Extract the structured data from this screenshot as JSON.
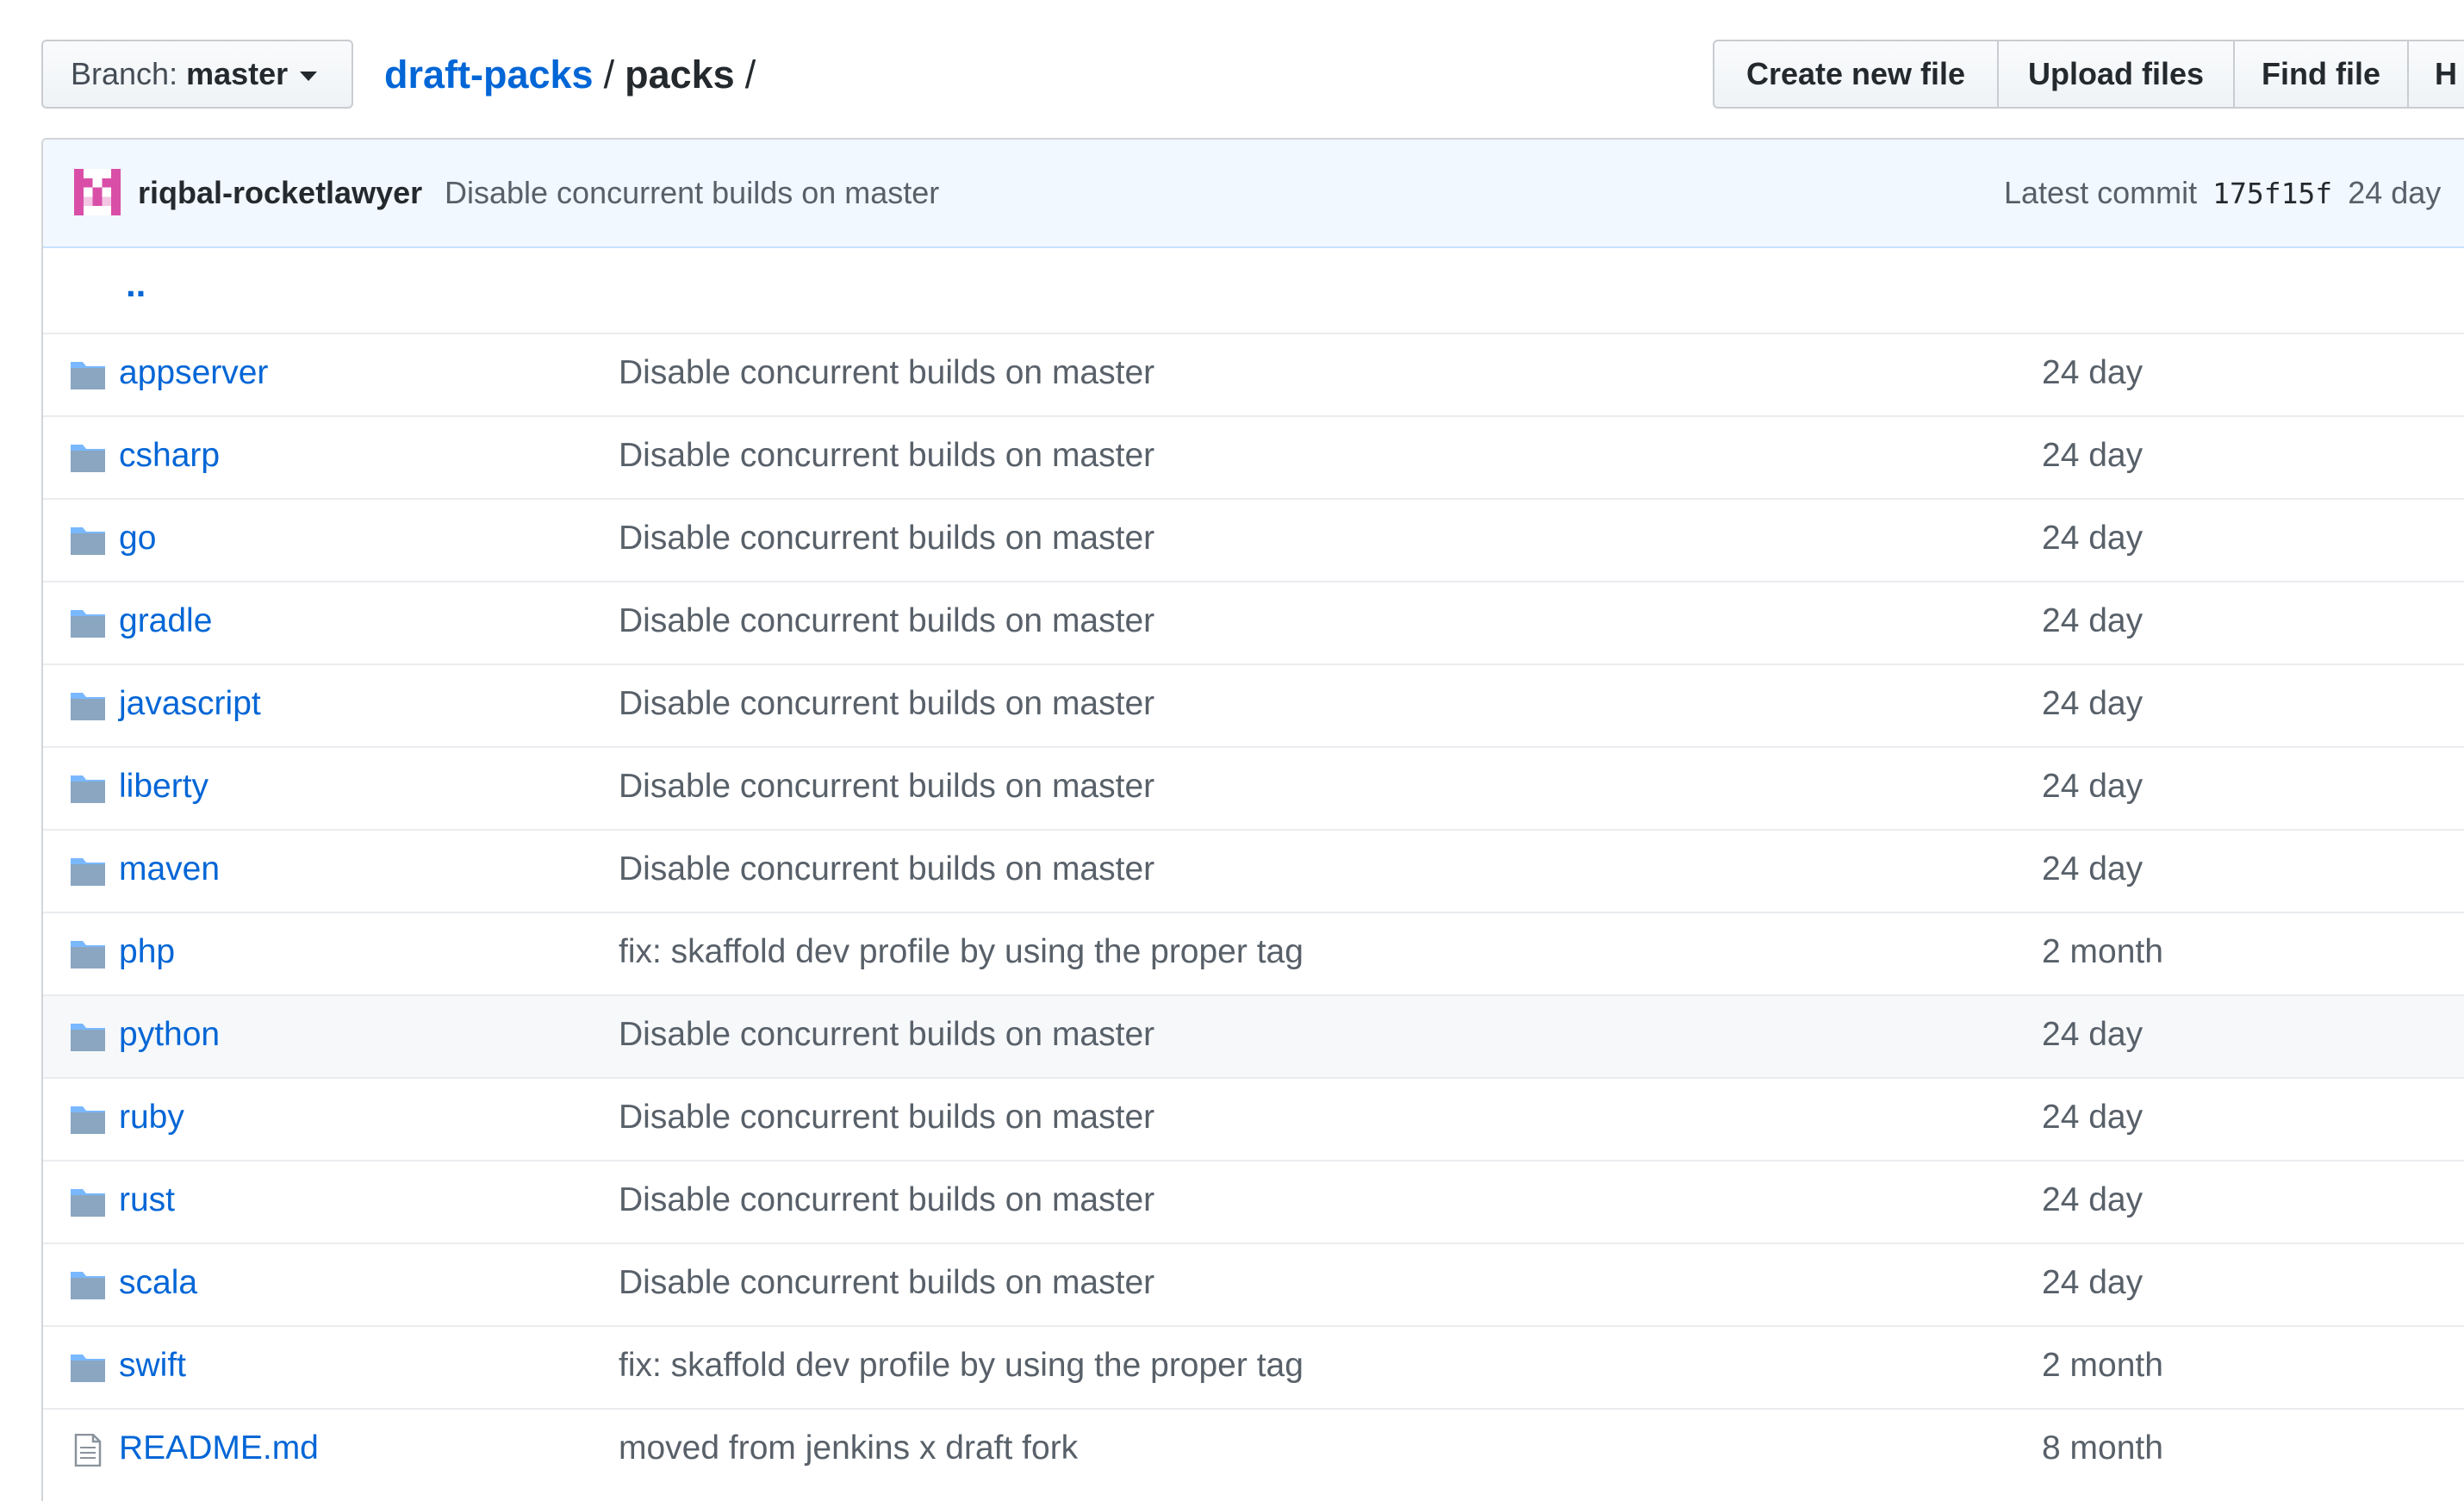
{
  "colors": {
    "link": "#0366d6",
    "text": "#24292e",
    "muted": "#586069",
    "commit_bg": "#f1f8ff",
    "folder_icon": "#79b8ff"
  },
  "nav": {
    "branch_prefix": "Branch:",
    "branch_name": "master",
    "breadcrumb_repo": "draft-packs",
    "breadcrumb_sep": "/",
    "breadcrumb_dir": "packs",
    "breadcrumb_trail": "/"
  },
  "actions": {
    "create": "Create new file",
    "upload": "Upload files",
    "find": "Find file",
    "history": "H"
  },
  "commit": {
    "author": "riqbal-rocketlawyer",
    "message": "Disable concurrent builds on master",
    "latest_label": "Latest commit",
    "sha": "175f15f",
    "age": "24 day"
  },
  "up_link": "..",
  "files": [
    {
      "name": "appserver",
      "type": "dir",
      "message": "Disable concurrent builds on master",
      "age": "24 day"
    },
    {
      "name": "csharp",
      "type": "dir",
      "message": "Disable concurrent builds on master",
      "age": "24 day"
    },
    {
      "name": "go",
      "type": "dir",
      "message": "Disable concurrent builds on master",
      "age": "24 day"
    },
    {
      "name": "gradle",
      "type": "dir",
      "message": "Disable concurrent builds on master",
      "age": "24 day"
    },
    {
      "name": "javascript",
      "type": "dir",
      "message": "Disable concurrent builds on master",
      "age": "24 day"
    },
    {
      "name": "liberty",
      "type": "dir",
      "message": "Disable concurrent builds on master",
      "age": "24 day"
    },
    {
      "name": "maven",
      "type": "dir",
      "message": "Disable concurrent builds on master",
      "age": "24 day"
    },
    {
      "name": "php",
      "type": "dir",
      "message": "fix: skaffold dev profile by using the proper tag",
      "age": "2 month"
    },
    {
      "name": "python",
      "type": "dir",
      "message": "Disable concurrent builds on master",
      "age": "24 day"
    },
    {
      "name": "ruby",
      "type": "dir",
      "message": "Disable concurrent builds on master",
      "age": "24 day"
    },
    {
      "name": "rust",
      "type": "dir",
      "message": "Disable concurrent builds on master",
      "age": "24 day"
    },
    {
      "name": "scala",
      "type": "dir",
      "message": "Disable concurrent builds on master",
      "age": "24 day"
    },
    {
      "name": "swift",
      "type": "dir",
      "message": "fix: skaffold dev profile by using the proper tag",
      "age": "2 month"
    },
    {
      "name": "README.md",
      "type": "file",
      "message": "moved from jenkins x draft fork",
      "age": "8 month"
    }
  ]
}
